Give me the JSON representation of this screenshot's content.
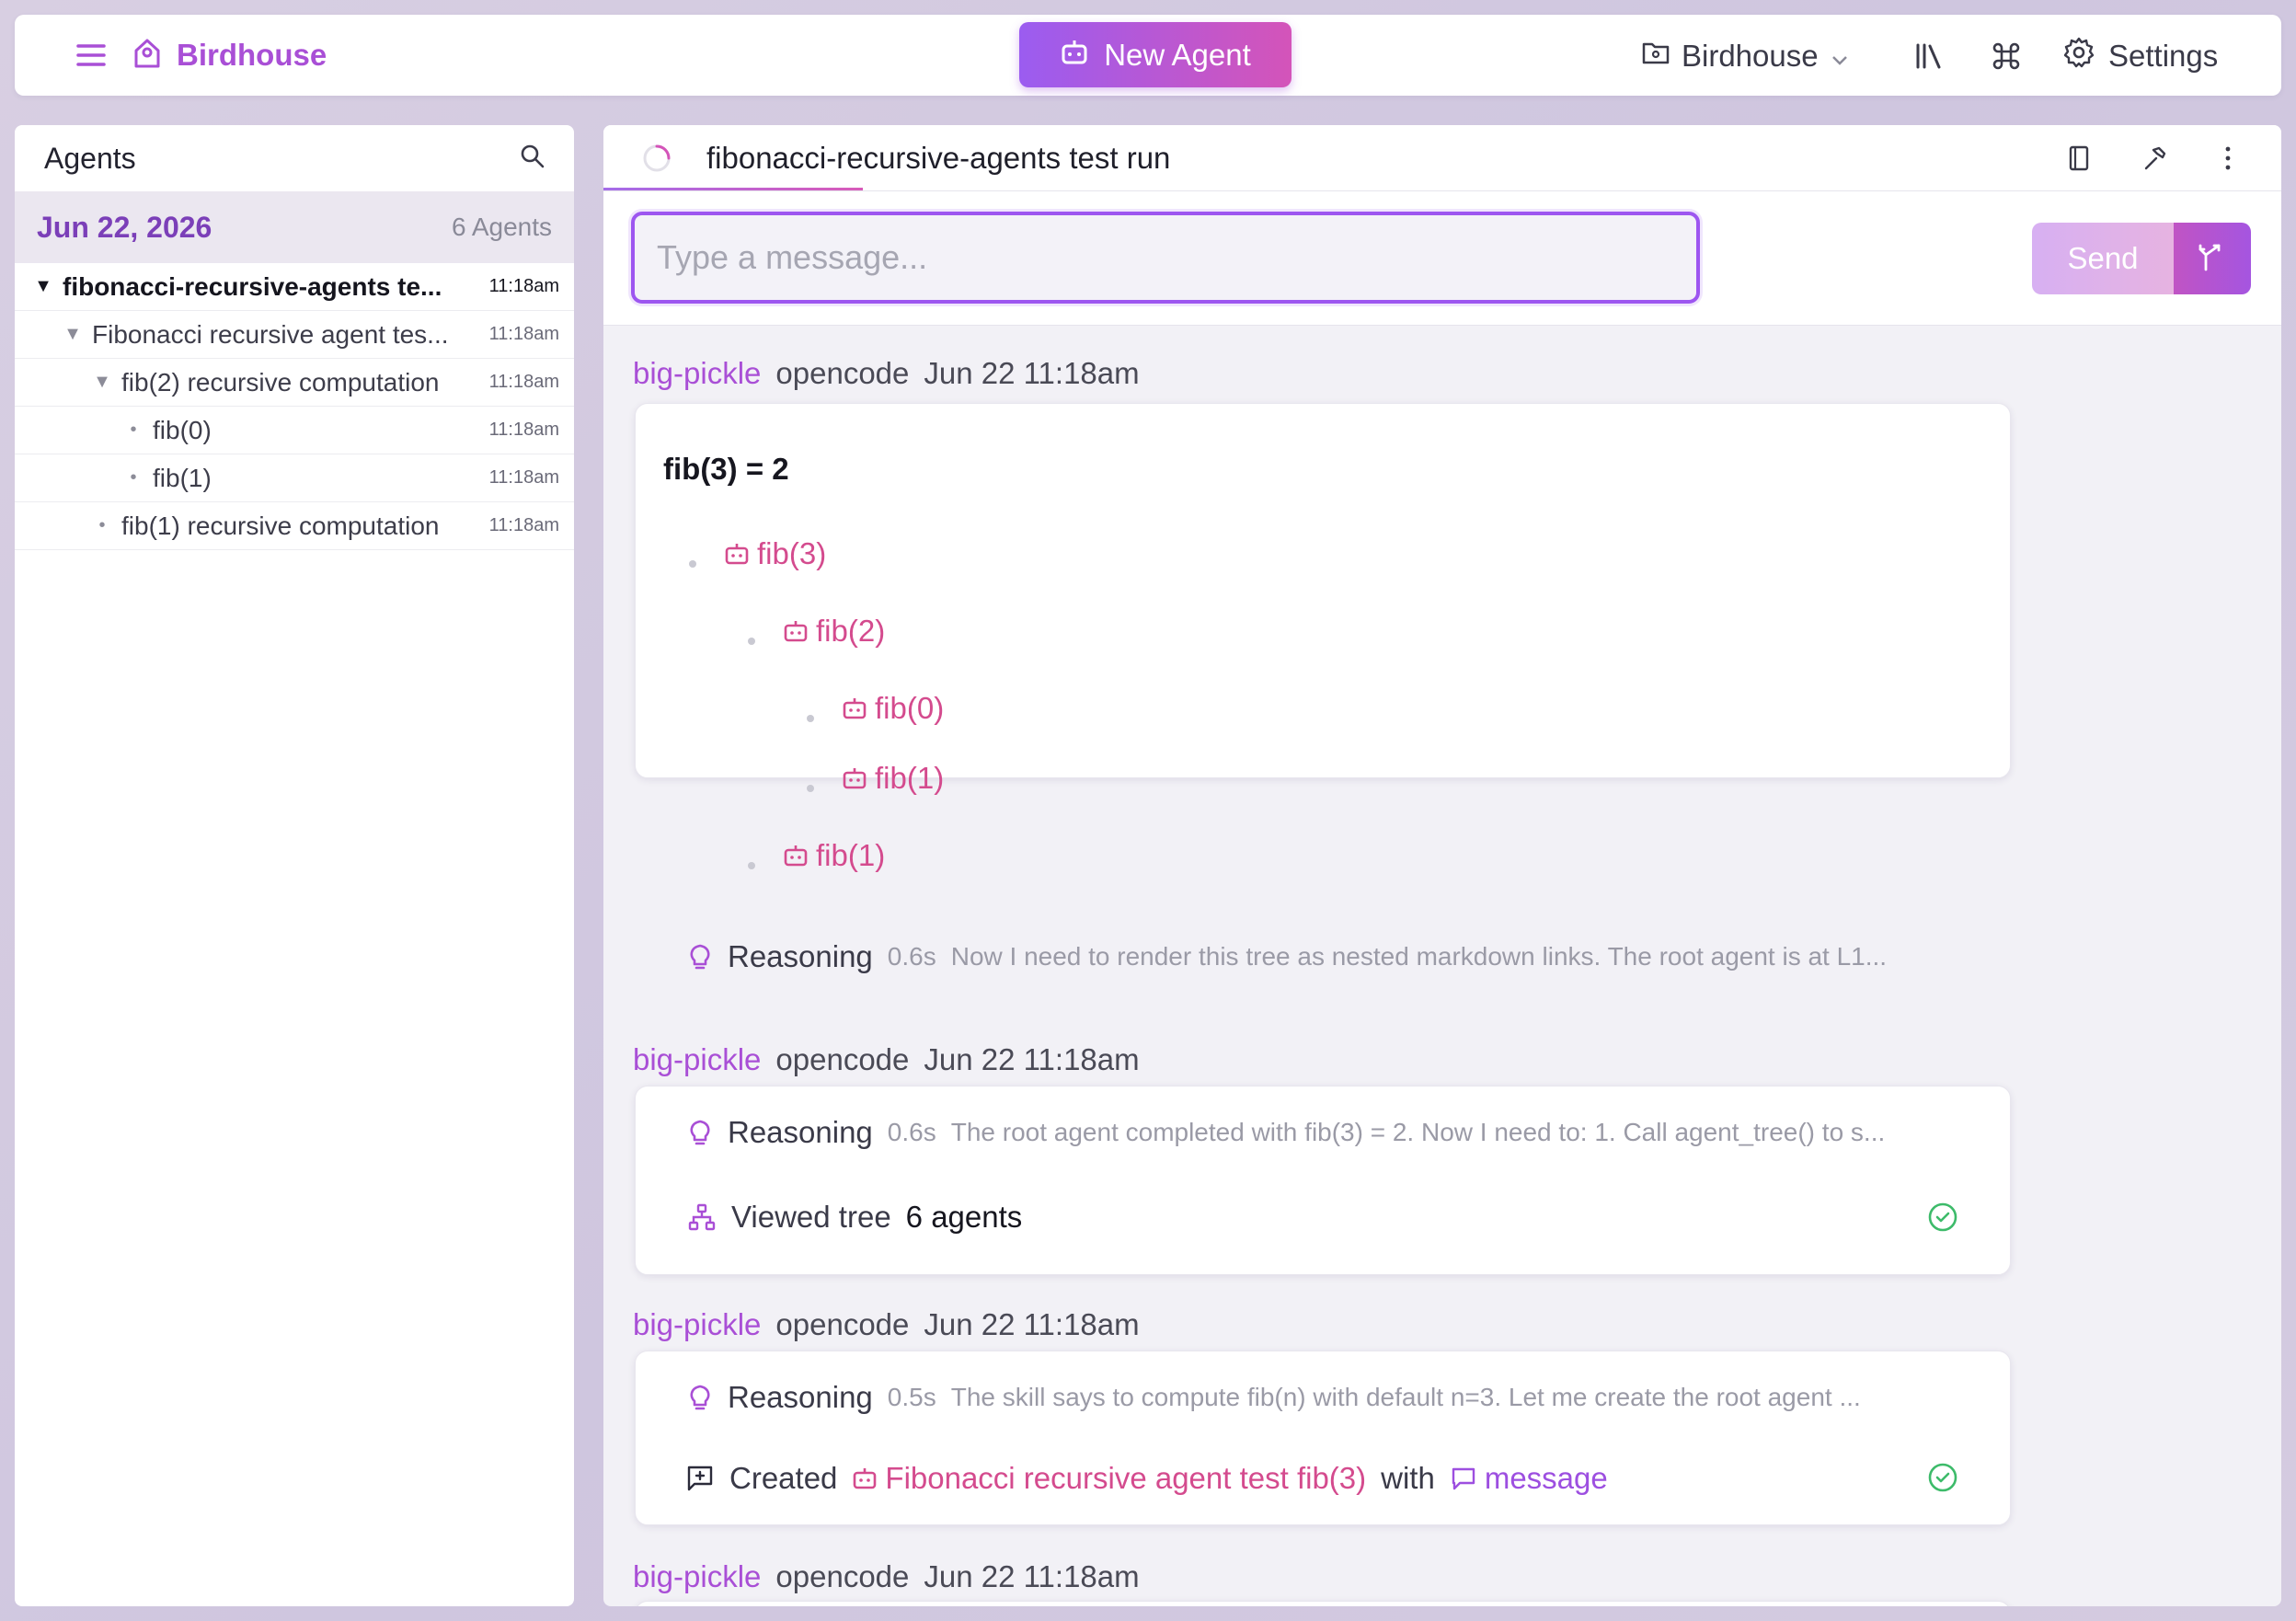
{
  "topbar": {
    "brand": "Birdhouse",
    "new_agent_label": "New Agent",
    "project": "Birdhouse",
    "settings_label": "Settings"
  },
  "sidebar": {
    "title": "Agents",
    "date": "Jun 22, 2026",
    "count": "6 Agents",
    "items": [
      {
        "label": "fibonacci-recursive-agents te...",
        "time": "11:18am"
      },
      {
        "label": "Fibonacci recursive agent tes...",
        "time": "11:18am"
      },
      {
        "label": "fib(2) recursive computation",
        "time": "11:18am"
      },
      {
        "label": "fib(0)",
        "time": "11:18am"
      },
      {
        "label": "fib(1)",
        "time": "11:18am"
      },
      {
        "label": "fib(1) recursive computation",
        "time": "11:18am"
      }
    ]
  },
  "main": {
    "title": "fibonacci-recursive-agents test run",
    "input_placeholder": "Type a message...",
    "send_label": "Send"
  },
  "messages": [
    {
      "user": "big-pickle",
      "model": "opencode",
      "time": "Jun 22 11:18am",
      "heading": "fib(3) = 2",
      "tree": [
        "fib(3)",
        "fib(2)",
        "fib(0)",
        "fib(1)",
        "fib(1)"
      ],
      "reasoning": {
        "label": "Reasoning",
        "duration": "0.6s",
        "text": "Now I need to render this tree as nested markdown links. The root agent is at L1..."
      }
    },
    {
      "user": "big-pickle",
      "model": "opencode",
      "time": "Jun 22 11:18am",
      "reasoning": {
        "label": "Reasoning",
        "duration": "0.6s",
        "text": "The root agent completed with fib(3) = 2. Now I need to: 1. Call agent_tree() to s..."
      },
      "tool": {
        "label": "Viewed tree",
        "value": "6 agents"
      }
    },
    {
      "user": "big-pickle",
      "model": "opencode",
      "time": "Jun 22 11:18am",
      "reasoning": {
        "label": "Reasoning",
        "duration": "0.5s",
        "text": "The skill says to compute fib(n) with default n=3. Let me create the root agent ..."
      },
      "tool": {
        "label": "Created",
        "agent": "Fibonacci recursive agent test fib(3)",
        "with": "with",
        "link": "message"
      }
    },
    {
      "user": "big-pickle",
      "model": "opencode",
      "time": "Jun 22 11:18am"
    }
  ],
  "colors": {
    "accent_purple": "#a94fd6",
    "link_pink": "#d44b8e",
    "success_green": "#3dbb6a"
  }
}
